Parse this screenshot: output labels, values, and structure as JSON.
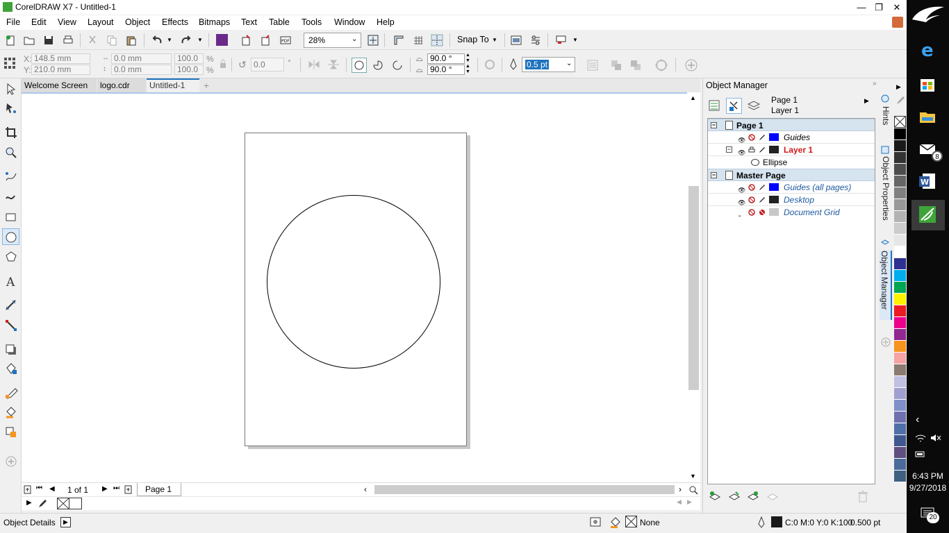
{
  "window": {
    "title": "CorelDRAW X7 - Untitled-1",
    "minimize": "—",
    "restore": "❐",
    "close": "✕"
  },
  "menu": [
    "File",
    "Edit",
    "View",
    "Layout",
    "Object",
    "Effects",
    "Bitmaps",
    "Text",
    "Table",
    "Tools",
    "Window",
    "Help"
  ],
  "std_toolbar": {
    "zoom": "28%",
    "snap_to": "Snap To"
  },
  "prop_bar": {
    "x_label": "X:",
    "x_value": "148.5 mm",
    "y_label": "Y:",
    "y_value": "210.0 mm",
    "width_value": "0.0 mm",
    "height_value": "0.0 mm",
    "scale_w": "100.0",
    "scale_h": "100.0",
    "pct1": "%",
    "pct2": "%",
    "rotation": "0.0",
    "degree": "°",
    "start_angle": "90.0 °",
    "end_angle": "90.0 °",
    "outline_width": "0.5 pt"
  },
  "doc_tabs": [
    "Welcome Screen",
    "logo.cdr",
    "Untitled-1"
  ],
  "doc_tab_add": "+",
  "page_nav": {
    "page_count": "1 of 1",
    "page_tab": "Page 1"
  },
  "docker": {
    "title": "Object Manager",
    "current_page": "Page 1",
    "current_layer": "Layer 1",
    "tree": [
      {
        "type": "page",
        "label": "Page 1"
      },
      {
        "type": "layer",
        "label": "Guides",
        "color": "#0000ff",
        "style": "italic"
      },
      {
        "type": "layer",
        "label": "Layer 1",
        "color": "#222222",
        "style": "active"
      },
      {
        "type": "object",
        "label": "Ellipse"
      },
      {
        "type": "page",
        "label": "Master Page"
      },
      {
        "type": "layer",
        "label": "Guides (all pages)",
        "color": "#0000ff",
        "style": "master"
      },
      {
        "type": "layer",
        "label": "Desktop",
        "color": "#222222",
        "style": "master"
      },
      {
        "type": "layer",
        "label": "Document Grid",
        "color": "#c8c8c8",
        "style": "master"
      }
    ]
  },
  "vertical_tabs": [
    "Hints",
    "Object Properties",
    "Object Manager"
  ],
  "palette": [
    "#000000",
    "#1a1a1a",
    "#333333",
    "#4d4d4d",
    "#666666",
    "#808080",
    "#999999",
    "#b3b3b3",
    "#cccccc",
    "#e6e6e6",
    "#ffffff",
    "#2e3192",
    "#00aeef",
    "#00a651",
    "#fff200",
    "#ed1c24",
    "#ec008c",
    "#92278f",
    "#f7941d",
    "#f5a3a3",
    "#8c7b70",
    "#c0c0e0",
    "#a0a0d0",
    "#8090c8",
    "#7070b0",
    "#5070a8",
    "#405890",
    "#605080",
    "#4a6a9a",
    "#406080"
  ],
  "status": {
    "object_details": "Object Details",
    "fill_none": "None",
    "outline_color": "C:0 M:0 Y:0 K:100",
    "outline_width": "0.500 pt"
  },
  "taskbar": {
    "mail_badge": "8",
    "time": "6:43 PM",
    "date": "9/27/2018",
    "notif_count": "20"
  },
  "colors": {
    "accent": "#1e73be",
    "layer_active": "#d01818",
    "master_layer_text": "#1e5aa0"
  }
}
